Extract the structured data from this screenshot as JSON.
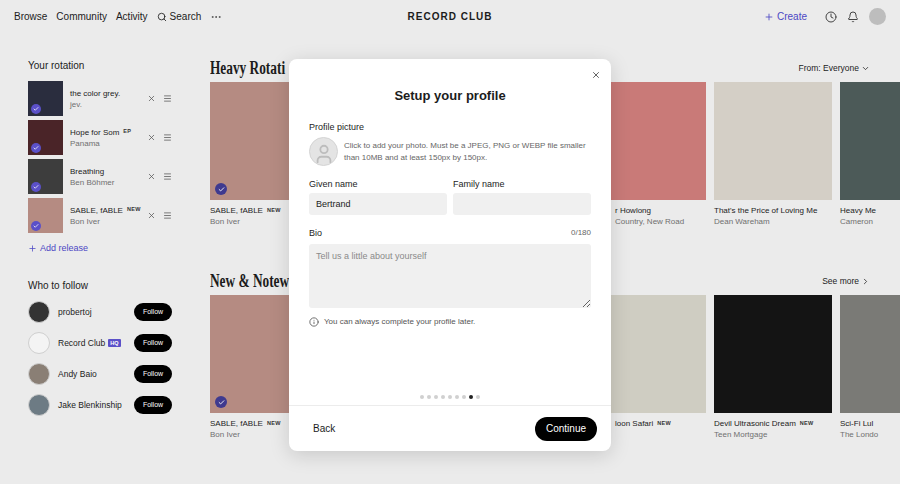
{
  "nav": {
    "links": [
      "Browse",
      "Community",
      "Activity"
    ],
    "search": "Search",
    "logo": "RECORD CLUB",
    "create": "Create"
  },
  "sidebar": {
    "rotation_title": "Your rotation",
    "rotation": [
      {
        "title": "the color grey.",
        "artist": "jev.",
        "checked": true,
        "color": "#2a2d3e"
      },
      {
        "title": "Hope for Som",
        "badge": "EP",
        "artist": "Panama",
        "checked": true,
        "color": "#4a2428"
      },
      {
        "title": "Breathing",
        "artist": "Ben Böhmer",
        "checked": true,
        "color": "#3d3d3d"
      },
      {
        "title": "SABLE, fABLE",
        "badge": "NEW",
        "artist": "Bon Iver",
        "checked": true,
        "color": "#b58b82"
      }
    ],
    "add_release": "Add release",
    "follow_title": "Who to follow",
    "follow": [
      {
        "name": "probertoj",
        "button": "Follow",
        "color": "#333333"
      },
      {
        "name": "Record Club",
        "badge": "HQ",
        "button": "Follow",
        "color": "#f4f4f4"
      },
      {
        "name": "Andy Baio",
        "button": "Follow",
        "color": "#8a7f75"
      },
      {
        "name": "Jake Blenkinship",
        "button": "Follow",
        "color": "#6d7b84"
      }
    ]
  },
  "sections": [
    {
      "title": "Heavy Rotati",
      "action": "From: Everyone",
      "action_kind": "dropdown",
      "cards": [
        {
          "kind": "full",
          "title": "SABLE, fABLE",
          "badge": "NEW",
          "artist": "Bon Iver",
          "checked": true,
          "color": "#b58b82"
        },
        {
          "kind": "cut",
          "title": "r Howlong",
          "artist": "Country, New Road",
          "checked": false,
          "color": "#c97a78"
        },
        {
          "kind": "full",
          "title": "That's the Price of Loving Me",
          "artist": "Dean Wareham",
          "checked": false,
          "color": "#d4cfc6"
        },
        {
          "kind": "full",
          "title": "Heavy Me",
          "artist": "Cameron",
          "checked": false,
          "color": "#4c5a58"
        }
      ]
    },
    {
      "title": "New & Notewo",
      "action": "See more",
      "action_kind": "link",
      "cards": [
        {
          "kind": "full",
          "title": "SABLE, fABLE",
          "badge": "NEW",
          "artist": "Bon Iver",
          "checked": true,
          "color": "#b58b82"
        },
        {
          "kind": "cut",
          "title": "loon Safari",
          "badge": "NEW",
          "checked": false,
          "color": "#cfcdc2"
        },
        {
          "kind": "full",
          "title": "Devil Ultrasonic Dream",
          "badge": "NEW",
          "artist": "Teen Mortgage",
          "checked": false,
          "color": "#141414"
        },
        {
          "kind": "full",
          "title": "Sci-Fi Lul",
          "artist": "The Londo",
          "checked": false,
          "color": "#7a7a76"
        }
      ]
    }
  ],
  "dialog": {
    "title": "Setup your profile",
    "picture_label": "Profile picture",
    "picture_hint": "Click to add your photo. Must be a JPEG, PNG or WEBP file smaller than 10MB and at least 150px by 150px.",
    "fields": [
      {
        "label": "Given name",
        "value": "Bertrand"
      },
      {
        "label": "Family name",
        "value": ""
      }
    ],
    "bio": {
      "label": "Bio",
      "count": "0/180",
      "placeholder": "Tell us a little about yourself"
    },
    "note": "You can always complete your profile later.",
    "steps": [
      {
        "selected": false
      },
      {
        "selected": false
      },
      {
        "selected": false
      },
      {
        "selected": false
      },
      {
        "selected": false
      },
      {
        "selected": false
      },
      {
        "selected": false
      },
      {
        "selected": true
      },
      {
        "selected": false
      }
    ],
    "back": "Back",
    "continue": "Continue"
  }
}
